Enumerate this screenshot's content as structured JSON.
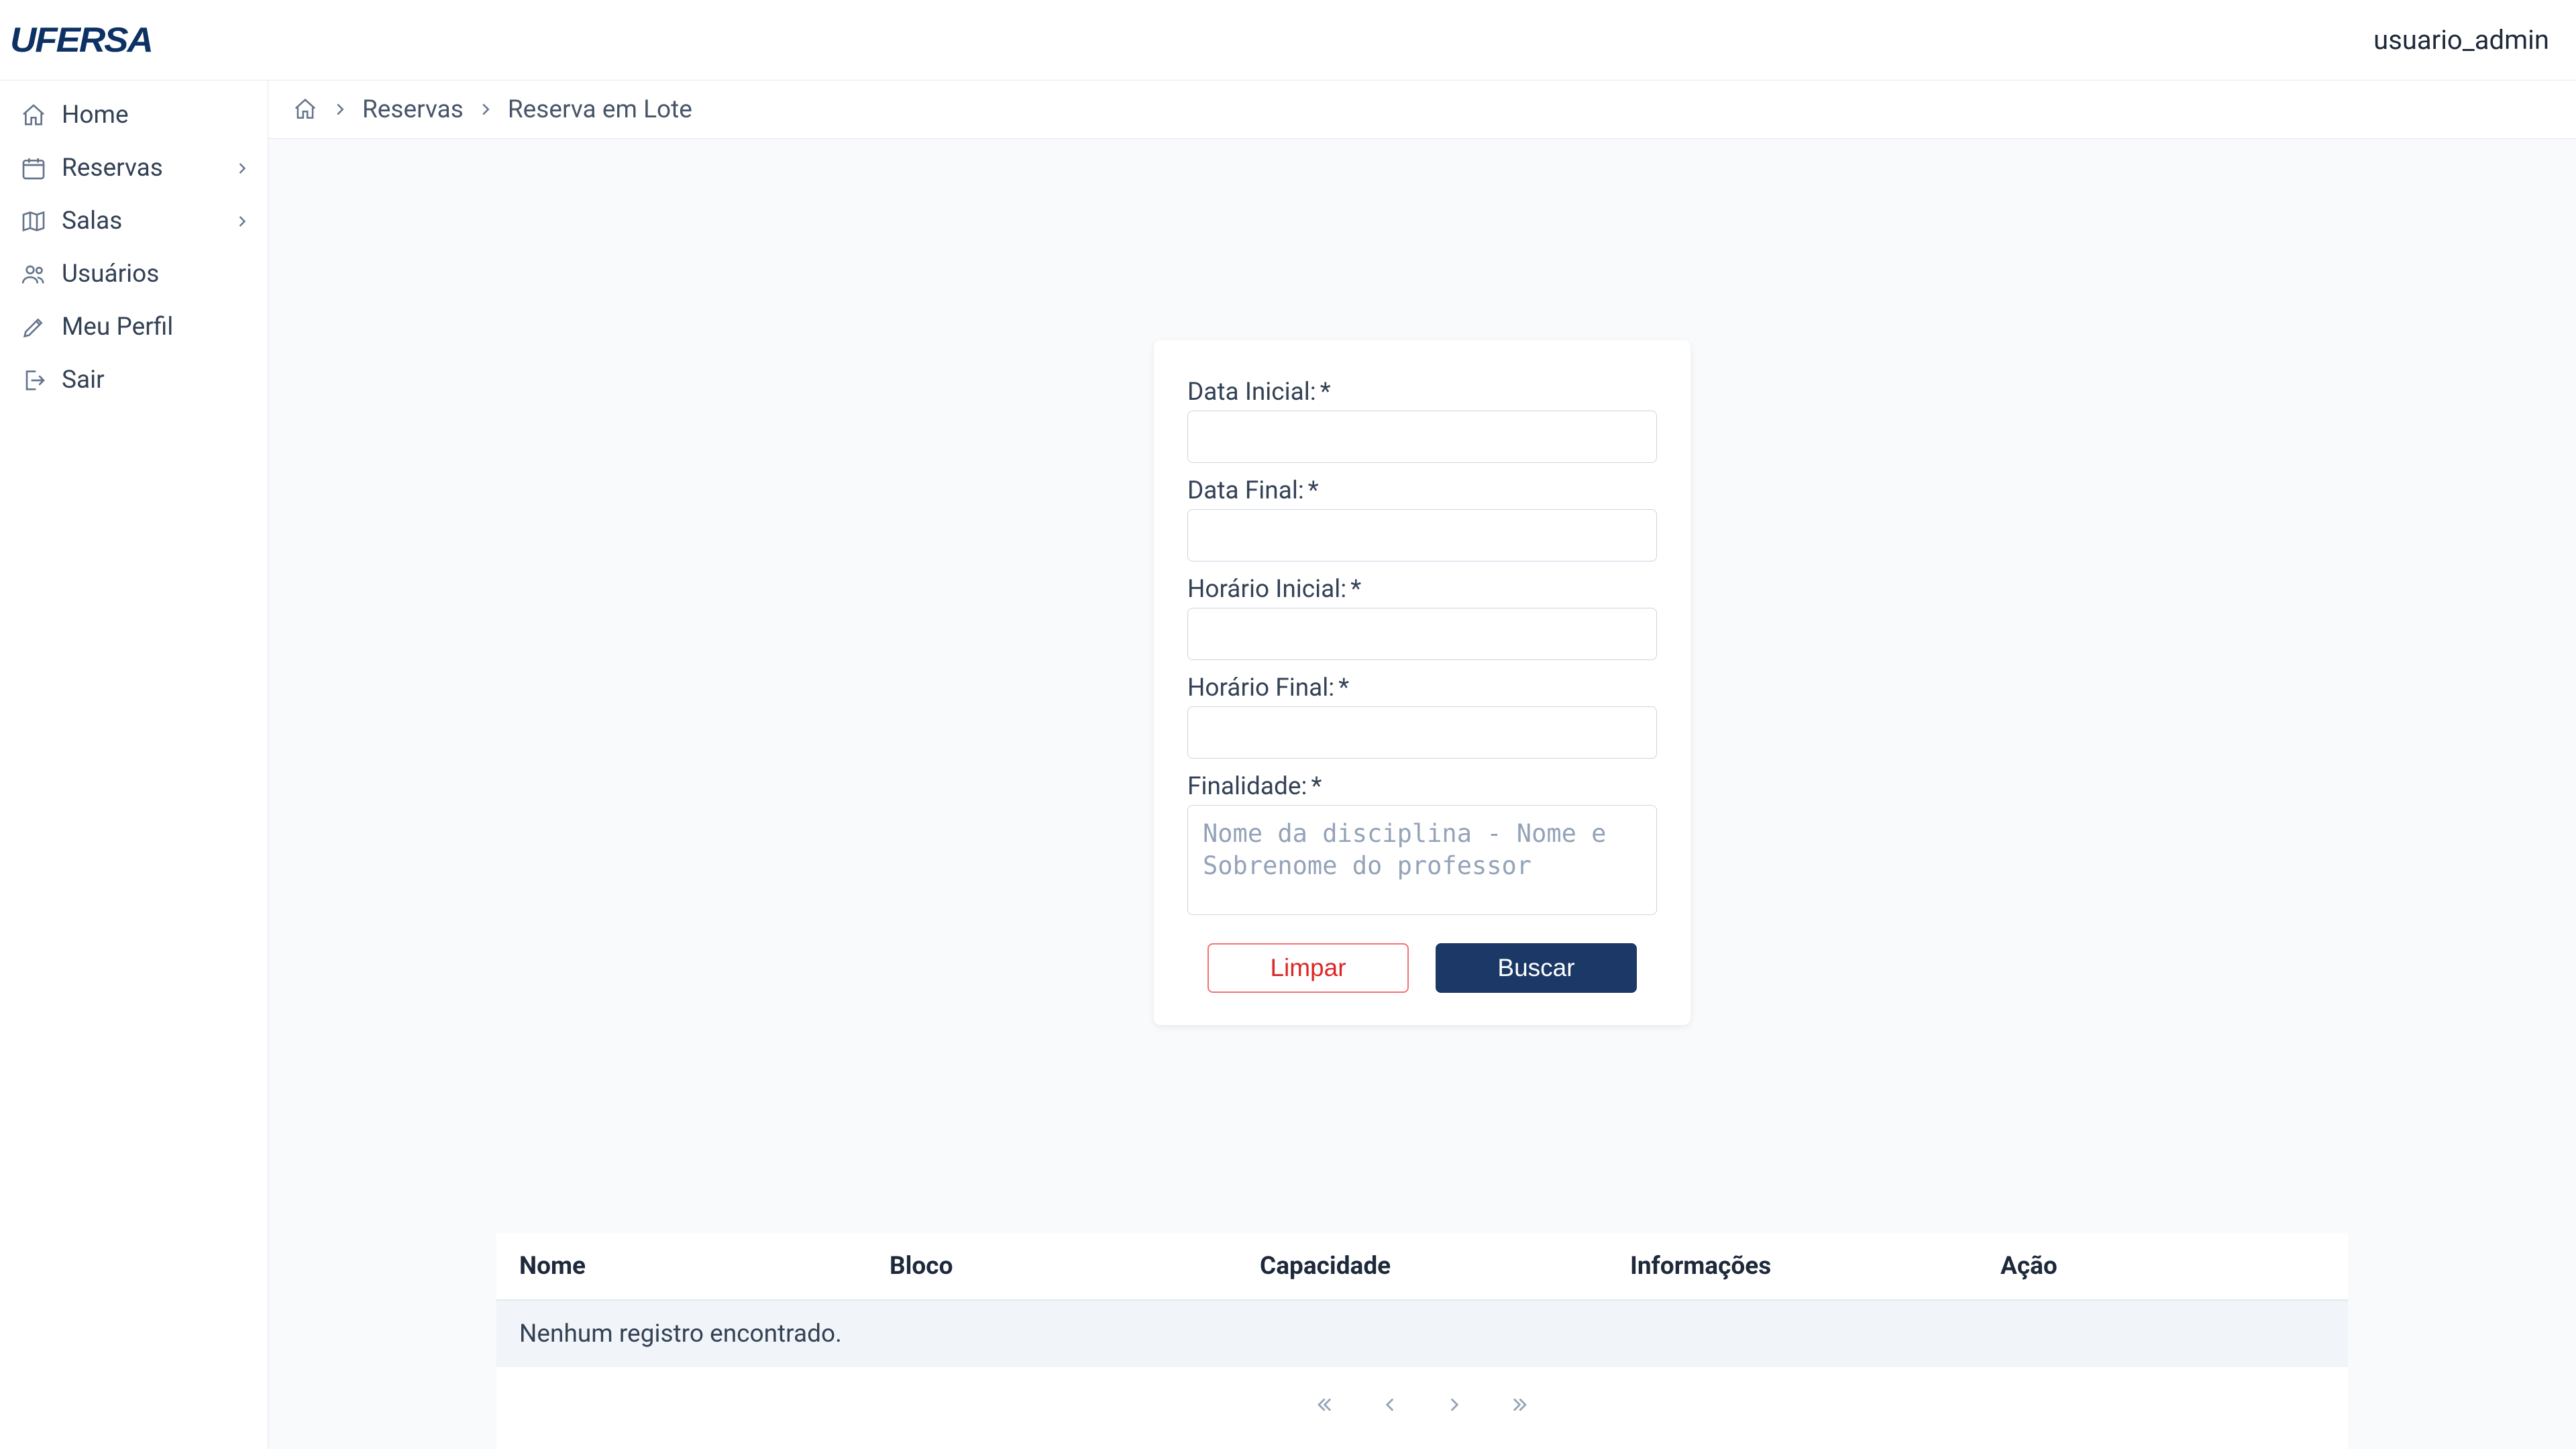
{
  "header": {
    "brand": "UFERSA",
    "username": "usuario_admin"
  },
  "sidebar": {
    "items": [
      {
        "label": "Home",
        "icon": "home-icon",
        "expandable": false
      },
      {
        "label": "Reservas",
        "icon": "calendar-icon",
        "expandable": true
      },
      {
        "label": "Salas",
        "icon": "map-icon",
        "expandable": true
      },
      {
        "label": "Usuários",
        "icon": "users-icon",
        "expandable": false
      },
      {
        "label": "Meu Perfil",
        "icon": "pencil-icon",
        "expandable": false
      },
      {
        "label": "Sair",
        "icon": "logout-icon",
        "expandable": false
      }
    ]
  },
  "breadcrumb": {
    "level1": "Reservas",
    "level2": "Reserva em Lote"
  },
  "form": {
    "data_inicial_label": "Data Inicial:",
    "data_final_label": "Data Final:",
    "horario_inicial_label": "Horário Inicial:",
    "horario_final_label": "Horário Final:",
    "finalidade_label": "Finalidade:",
    "finalidade_placeholder": "Nome da disciplina - Nome e Sobrenome do professor",
    "required_mark": "*",
    "clear_label": "Limpar",
    "search_label": "Buscar"
  },
  "table": {
    "columns": {
      "nome": "Nome",
      "bloco": "Bloco",
      "capacidade": "Capacidade",
      "informacoes": "Informações",
      "acao": "Ação"
    },
    "empty_message": "Nenhum registro encontrado."
  }
}
